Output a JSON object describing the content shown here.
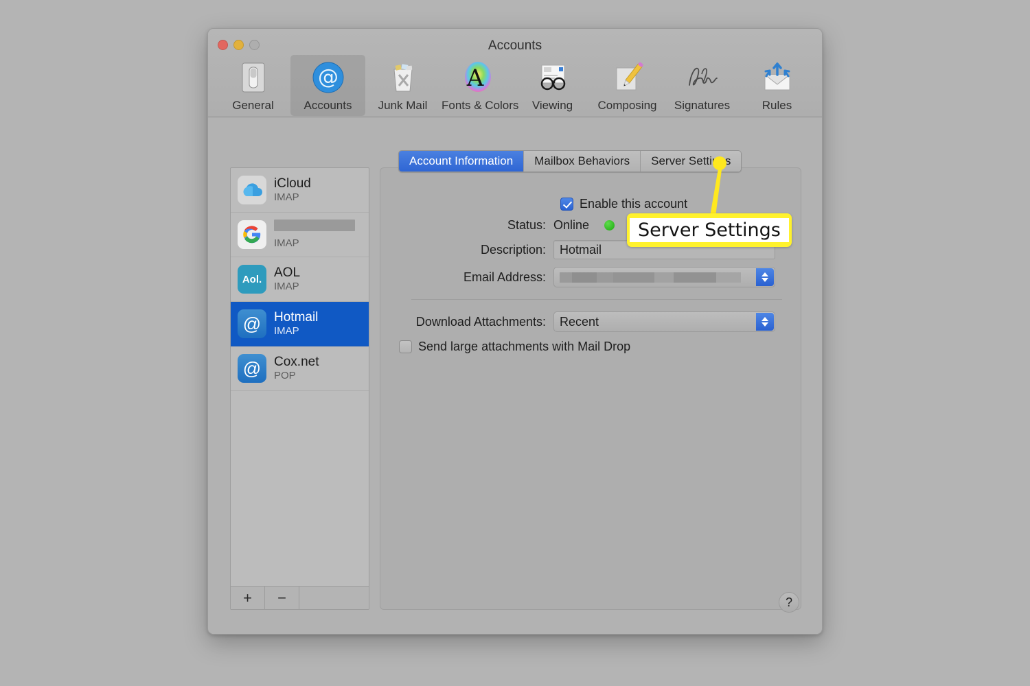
{
  "window": {
    "title": "Accounts",
    "traffic_lights": [
      "close-red",
      "minimize-yellow",
      "zoom-green"
    ]
  },
  "toolbar": {
    "items": [
      {
        "label": "General",
        "icon": "general-icon",
        "selected": false
      },
      {
        "label": "Accounts",
        "icon": "accounts-at-icon",
        "selected": true
      },
      {
        "label": "Junk Mail",
        "icon": "junk-mail-icon",
        "selected": false
      },
      {
        "label": "Fonts & Colors",
        "icon": "fonts-colors-icon",
        "selected": false
      },
      {
        "label": "Viewing",
        "icon": "viewing-icon",
        "selected": false
      },
      {
        "label": "Composing",
        "icon": "composing-icon",
        "selected": false
      },
      {
        "label": "Signatures",
        "icon": "signatures-icon",
        "selected": false
      },
      {
        "label": "Rules",
        "icon": "rules-icon",
        "selected": false
      }
    ]
  },
  "sidebar": {
    "accounts": [
      {
        "name": "iCloud",
        "protocol": "IMAP",
        "icon": "icloud-icon",
        "selected": false,
        "redacted": false
      },
      {
        "name": "",
        "protocol": "IMAP",
        "icon": "google-icon",
        "selected": false,
        "redacted": true
      },
      {
        "name": "AOL",
        "protocol": "IMAP",
        "icon": "aol-icon",
        "selected": false,
        "redacted": false
      },
      {
        "name": "Hotmail",
        "protocol": "IMAP",
        "icon": "at-sign-icon",
        "selected": true,
        "redacted": false
      },
      {
        "name": "Cox.net",
        "protocol": "POP",
        "icon": "at-sign-icon",
        "selected": false,
        "redacted": false
      }
    ],
    "add_label": "+",
    "remove_label": "−"
  },
  "tabs": [
    {
      "label": "Account Information",
      "active": true
    },
    {
      "label": "Mailbox Behaviors",
      "active": false
    },
    {
      "label": "Server Settings",
      "active": false
    }
  ],
  "form": {
    "enable_account_label": "Enable this account",
    "enable_account_checked": true,
    "status_label": "Status:",
    "status_value": "Online",
    "status_color": "#1aa80f",
    "description_label": "Description:",
    "description_value": "Hotmail",
    "email_label": "Email Address:",
    "email_value": "",
    "download_attachments_label": "Download Attachments:",
    "download_attachments_value": "Recent",
    "mail_drop_label": "Send large attachments with Mail Drop",
    "mail_drop_checked": false
  },
  "help_button_label": "?",
  "callout": {
    "text": "Server Settings",
    "box_color": "#fff22d",
    "text_color": "#141414",
    "target": "Server Settings tab"
  }
}
